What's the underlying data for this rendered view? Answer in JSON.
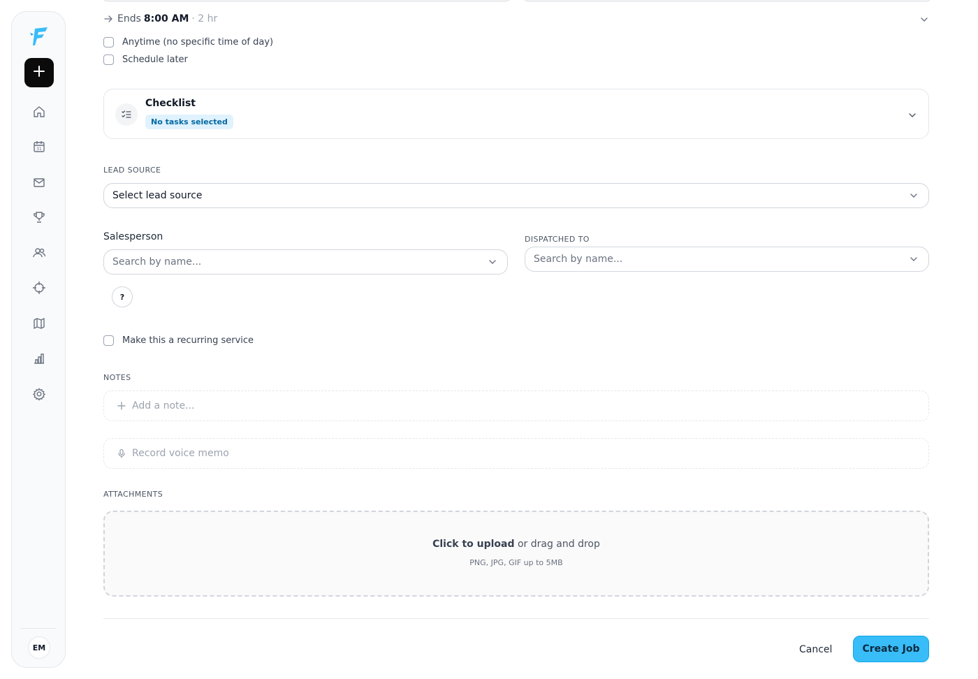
{
  "schedule": {
    "ends_prefix": "Ends",
    "ends_time": "8:00 AM",
    "duration": "· 2 hr",
    "anytime_label": "Anytime (no specific time of day)",
    "schedule_later_label": "Schedule later"
  },
  "checklist": {
    "title": "Checklist",
    "badge": "No tasks selected"
  },
  "lead_source": {
    "label": "LEAD SOURCE",
    "value": "Select lead source"
  },
  "salesperson": {
    "label": "Salesperson",
    "placeholder": "Search by name...",
    "help": "?"
  },
  "dispatched": {
    "label": "DISPATCHED TO",
    "placeholder": "Search by name..."
  },
  "recurring": {
    "label": "Make this a recurring service"
  },
  "notes": {
    "label": "NOTES",
    "add_note": "Add a note...",
    "voice_memo": "Record voice memo"
  },
  "attachments": {
    "label": "ATTACHMENTS",
    "click_upload": "Click to upload",
    "drag_text": " or drag and drop",
    "formats": "PNG, JPG, GIF up to 5MB"
  },
  "actions": {
    "cancel": "Cancel",
    "create": "Create Job"
  },
  "user": {
    "initials": "EM"
  },
  "sidebar": {
    "icons": [
      "home-icon",
      "calendar-icon",
      "mail-icon",
      "trophy-icon",
      "users-icon",
      "crosshair-icon",
      "map-icon",
      "bar-chart-icon",
      "gear-icon"
    ]
  },
  "colors": {
    "accent": "#38bdf8",
    "badge_bg": "#e0f2fe",
    "badge_text": "#0369a1",
    "logo": "#38bdf8"
  }
}
